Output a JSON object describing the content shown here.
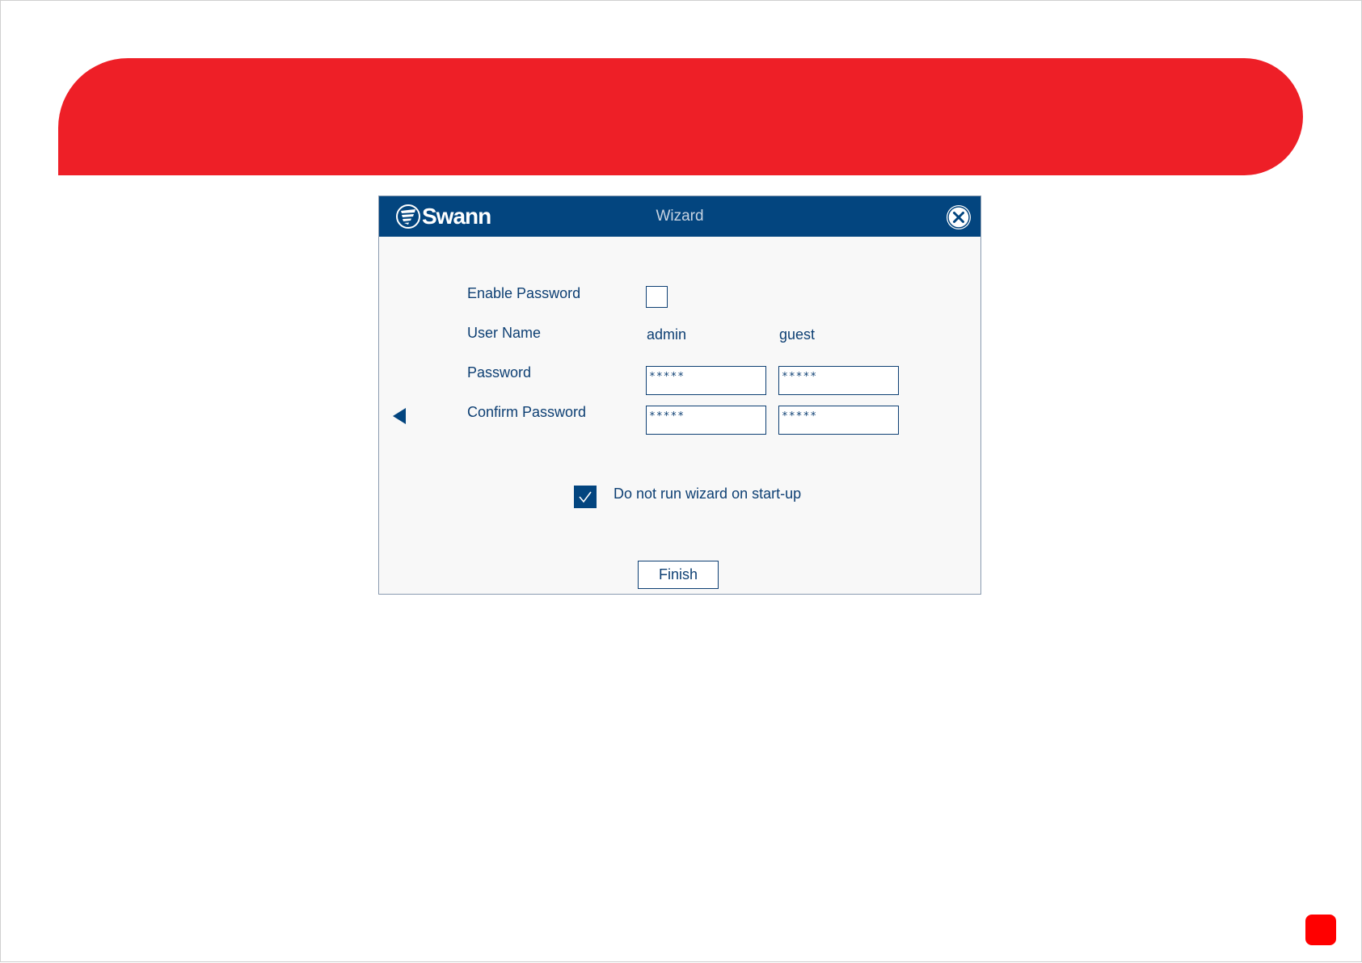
{
  "colors": {
    "banner": "#ee1f27",
    "titlebar": "#03457f",
    "text": "#0d3f73",
    "badge": "#ff0000"
  },
  "dialog": {
    "brand": "Swann",
    "title": "Wizard",
    "close_icon": "close-circle-x",
    "enable_password": {
      "label": "Enable Password",
      "checked": false
    },
    "user_name": {
      "label": "User Name",
      "admin": "admin",
      "guest": "guest"
    },
    "password": {
      "label": "Password",
      "admin_value": "*****",
      "guest_value": "*****"
    },
    "confirm_password": {
      "label": "Confirm Password",
      "admin_value": "*****",
      "guest_value": "*****"
    },
    "nav_icon": "left-arrow",
    "skip_wizard": {
      "label": "Do not run wizard on start-up",
      "checked": true
    },
    "finish_label": "Finish"
  }
}
